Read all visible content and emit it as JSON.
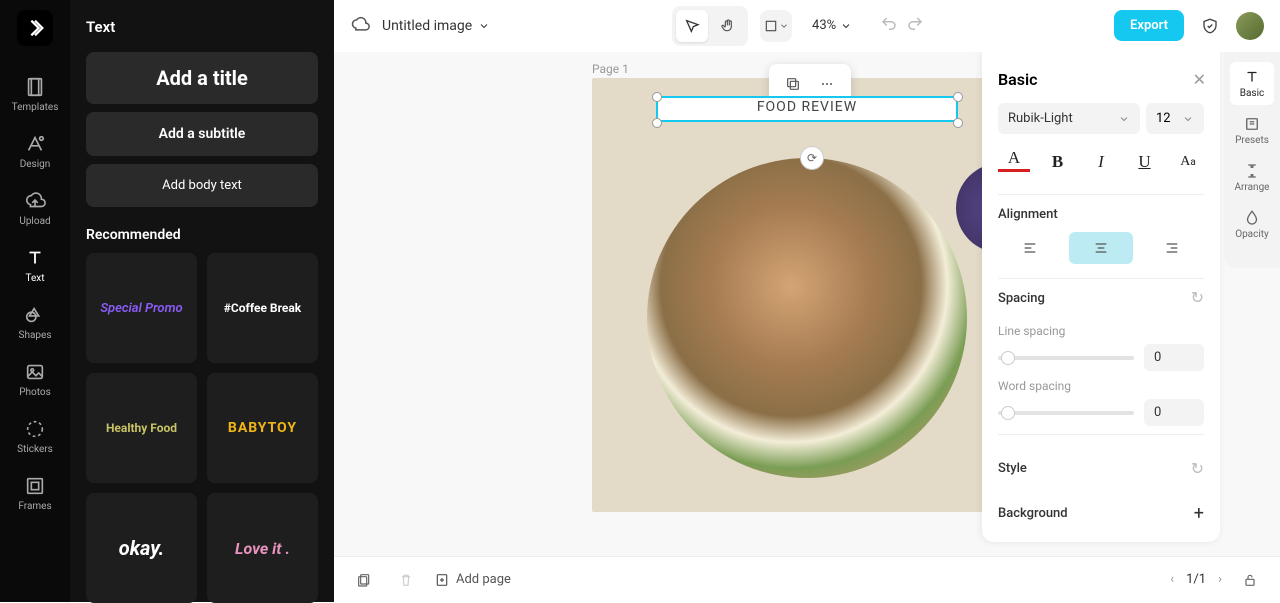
{
  "leftRail": {
    "items": [
      {
        "label": "Templates"
      },
      {
        "label": "Design"
      },
      {
        "label": "Upload"
      },
      {
        "label": "Text"
      },
      {
        "label": "Shapes"
      },
      {
        "label": "Photos"
      },
      {
        "label": "Stickers"
      },
      {
        "label": "Frames"
      }
    ]
  },
  "textPanel": {
    "heading": "Text",
    "addTitle": "Add a title",
    "addSubtitle": "Add a subtitle",
    "addBody": "Add body text",
    "recLabel": "Recommended",
    "presets": [
      {
        "text": "Special Promo",
        "color": "#8a5cf7",
        "style": "italic"
      },
      {
        "text": "#Coffee Break",
        "color": "#fff",
        "style": "bold"
      },
      {
        "text": "Healthy Food",
        "color": "#c8c266",
        "style": "bold"
      },
      {
        "text": "BABYTOY",
        "color": "#f0b615",
        "style": "bold"
      },
      {
        "text": "okay.",
        "color": "#fff",
        "style": "scripty"
      },
      {
        "text": "Love it .",
        "color": "#e893be",
        "style": "scripty"
      }
    ]
  },
  "topbar": {
    "title": "Untitled image",
    "zoom": "43%",
    "export": "Export"
  },
  "canvas": {
    "pageLabel": "Page 1",
    "selectedText": "FOOD REVIEW"
  },
  "props": {
    "head": "Basic",
    "font": "Rubik-Light",
    "size": "12",
    "alignLabel": "Alignment",
    "spacingLabel": "Spacing",
    "lineSpacing": "Line spacing",
    "lineVal": "0",
    "wordSpacing": "Word spacing",
    "wordVal": "0",
    "styleLabel": "Style",
    "bgLabel": "Background"
  },
  "rightRail": {
    "items": [
      {
        "label": "Basic"
      },
      {
        "label": "Presets"
      },
      {
        "label": "Arrange"
      },
      {
        "label": "Opacity"
      }
    ]
  },
  "bottom": {
    "addPage": "Add page",
    "pager": "1/1"
  }
}
